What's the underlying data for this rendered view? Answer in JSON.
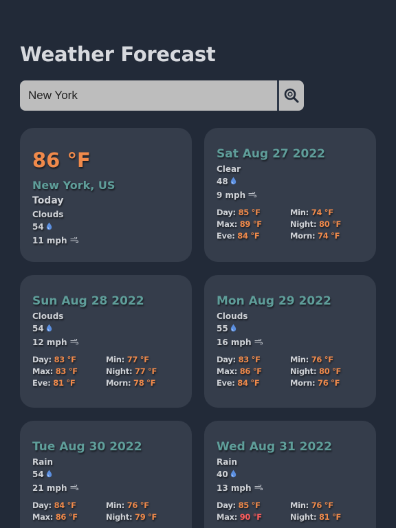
{
  "title": "Weather Forecast",
  "search": {
    "value": "New York",
    "icon": "search-icon"
  },
  "current": {
    "temp": "86 °F",
    "city": "New York, US",
    "day": "Today",
    "condition": "Clouds",
    "humidity": "54",
    "wind": "11 mph"
  },
  "forecast": [
    {
      "date": "Sat Aug 27 2022",
      "condition": "Clear",
      "humidity": "48",
      "wind": "9 mph",
      "day": "85 °F",
      "min": "74 °F",
      "max": "89 °F",
      "night": "80 °F",
      "eve": "84 °F",
      "morn": "74 °F"
    },
    {
      "date": "Sun Aug 28 2022",
      "condition": "Clouds",
      "humidity": "54",
      "wind": "12 mph",
      "day": "83 °F",
      "min": "77 °F",
      "max": "83 °F",
      "night": "77 °F",
      "eve": "81 °F",
      "morn": "78 °F"
    },
    {
      "date": "Mon Aug 29 2022",
      "condition": "Clouds",
      "humidity": "55",
      "wind": "16 mph",
      "day": "83 °F",
      "min": "76 °F",
      "max": "86 °F",
      "night": "80 °F",
      "eve": "84 °F",
      "morn": "76 °F"
    },
    {
      "date": "Tue Aug 30 2022",
      "condition": "Rain",
      "humidity": "54",
      "wind": "21 mph",
      "day": "84 °F",
      "min": "76 °F",
      "max": "86 °F",
      "night": "79 °F",
      "eve": "",
      "morn": ""
    },
    {
      "date": "Wed Aug 31 2022",
      "condition": "Rain",
      "humidity": "40",
      "wind": "13 mph",
      "day": "85 °F",
      "min": "76 °F",
      "max": "90 °F",
      "night": "81 °F",
      "eve": "",
      "morn": ""
    }
  ],
  "labels": {
    "day": "Day: ",
    "min": "Min: ",
    "max": "Max: ",
    "night": "Night: ",
    "eve": "Eve: ",
    "morn": "Morn: "
  },
  "colors": {
    "background": "#222a38",
    "card": "#353d4b",
    "accent_teal": "#5f9e9a",
    "temp_orange": "#f08a4b",
    "temp_hot": "#ff5d5d",
    "humidity_blue": "#5b8fe0"
  },
  "icons": {
    "humidity": "water-drop-icon",
    "wind": "wind-icon"
  }
}
